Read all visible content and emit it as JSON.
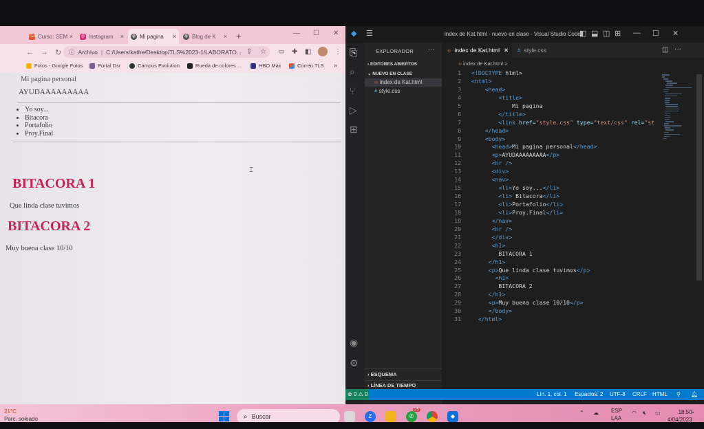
{
  "browser": {
    "tabs": [
      {
        "label": "Curso: SEM",
        "icon": "moodle-icon",
        "color": "#e8552e"
      },
      {
        "label": "Instagram",
        "icon": "instagram-icon",
        "color": "#d6307a"
      },
      {
        "label": "Mi pagina",
        "icon": "globe-icon",
        "color": "#555555"
      },
      {
        "label": "Blog de K",
        "icon": "globe-icon",
        "color": "#555555"
      }
    ],
    "new_tab": "+",
    "url_scheme": "Archivo",
    "url": "C:/Users/kathe/Desktop/TLS%2023-1/LABORATO...",
    "bookmarks": [
      {
        "label": "Fotos - Google Fotos",
        "color": "#f4b400"
      },
      {
        "label": "Portal Dsr",
        "color": "#7a5a9a"
      },
      {
        "label": "Campus Evolution",
        "color": "#333333"
      },
      {
        "label": "Rueda de colores ...",
        "color": "#222222"
      },
      {
        "label": "HBO Max",
        "color": "#3a2a8a"
      },
      {
        "label": "Correo TLS",
        "color": "#e8552e"
      }
    ],
    "page": {
      "head_text": "Mi pagina personal",
      "paragraph1": "AYUDAAAAAAAAA",
      "list": [
        "Yo soy...",
        "Bitacora",
        "Portafolio",
        "Proy.Final"
      ],
      "h1_1": "BITACORA 1",
      "paragraph2": "Que linda clase tuvimos",
      "h1_2": "BITACORA 2",
      "paragraph3": "Muy buena clase 10/10"
    }
  },
  "vscode": {
    "title": "index de Kat.html - nuevo en clase - Visual Studio Code",
    "explorer_title": "EXPLORADOR",
    "open_editors": "EDITORES ABIERTOS",
    "folder": "NUEVO EN CLASE",
    "files": [
      "index de Kat.html",
      "style.css"
    ],
    "outline": "ESQUEMA",
    "timeline": "LÍNEA DE TIEMPO",
    "tabs": [
      "index de Kat.html",
      "style.css"
    ],
    "breadcrumb": "index de Kat.html >",
    "code_lines": [
      "<!DOCTYPE html>",
      "<html>",
      "    <head>",
      "        <title>",
      "            Mi pagina",
      "        </title>",
      "        <link href=\"style.css\" type=\"text/css\" rel=\"st",
      "    </head>",
      "    <body>",
      "      <head>Mi pagina personal</head>",
      "      <p>AYUDAAAAAAAAA</p>",
      "      <hr />",
      "      <div>",
      "      <nav>",
      "        <li>Yo soy...</li>",
      "        <li> Bitacora</li>",
      "        <li>Portafolio</li>",
      "        <li>Proy.Final</li>",
      "      </nav>",
      "      <hr />",
      "      </div>",
      "      <h1>",
      "        BITACORA 1",
      "     </h1>",
      "     <p>Que linda clase tuvimos</p>",
      "       <h1>",
      "        BITACORA 2",
      "     </h1>",
      "     <p>Muy buena clase 10/10</p>",
      "     </body>",
      "  </html>"
    ],
    "status": {
      "problems": "⊗ 0 ⚠ 0",
      "position": "Lín. 1, col. 1",
      "spaces": "Espacios: 2",
      "encoding": "UTF-8",
      "eol": "CRLF",
      "language": "HTML"
    }
  },
  "taskbar": {
    "weather_temp": "21°C",
    "weather_desc": "Parc. soleado",
    "search": "Buscar",
    "lang": "ESP",
    "region": "LAA",
    "time": "18:50",
    "date": "4/04/2023",
    "badge": "25"
  }
}
